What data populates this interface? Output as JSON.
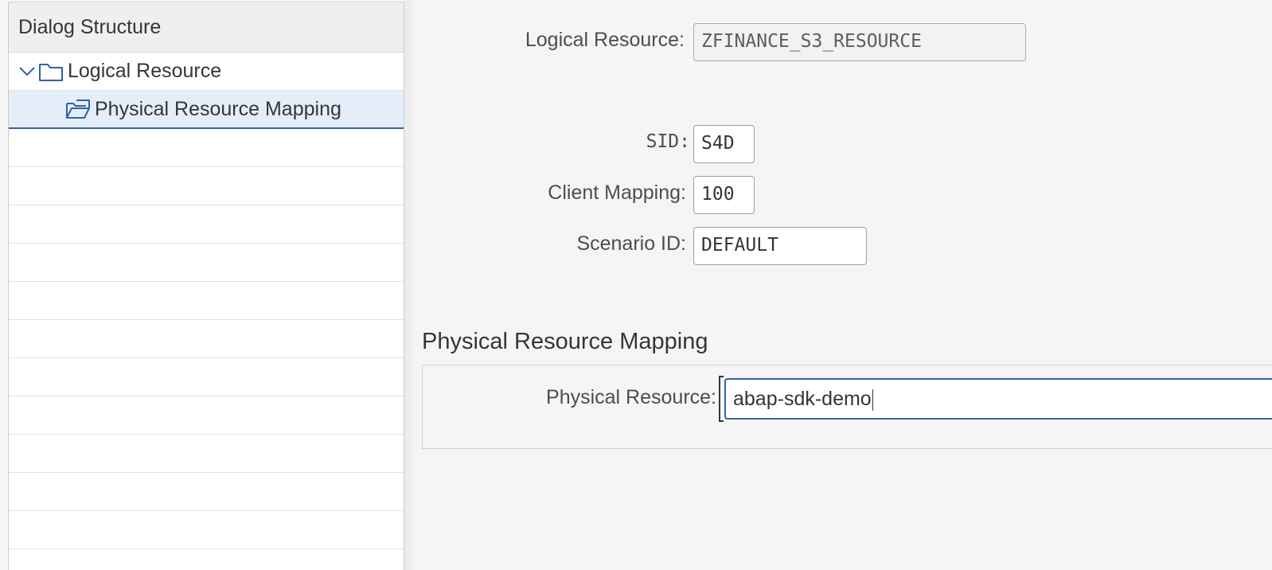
{
  "dialog_structure": {
    "title": "Dialog Structure",
    "items": [
      {
        "label": "Logical Resource",
        "expanded": true,
        "level": 1,
        "icon": "folder-closed-icon"
      },
      {
        "label": "Physical Resource Mapping",
        "level": 2,
        "selected": true,
        "icon": "folder-open-icon"
      }
    ]
  },
  "form": {
    "logical_resource": {
      "label": "Logical Resource:",
      "value": "ZFINANCE_S3_RESOURCE"
    },
    "sid": {
      "label": "SID:",
      "value": "S4D"
    },
    "client_mapping": {
      "label": "Client Mapping:",
      "value": "100"
    },
    "scenario_id": {
      "label": "Scenario ID:",
      "value": "DEFAULT"
    }
  },
  "section": {
    "title": "Physical Resource Mapping",
    "physical_resource": {
      "label": "Physical Resource:",
      "value": "abap-sdk-demo"
    }
  },
  "colors": {
    "selection_background": "#e5eef8",
    "focus_border": "#3063a6"
  }
}
